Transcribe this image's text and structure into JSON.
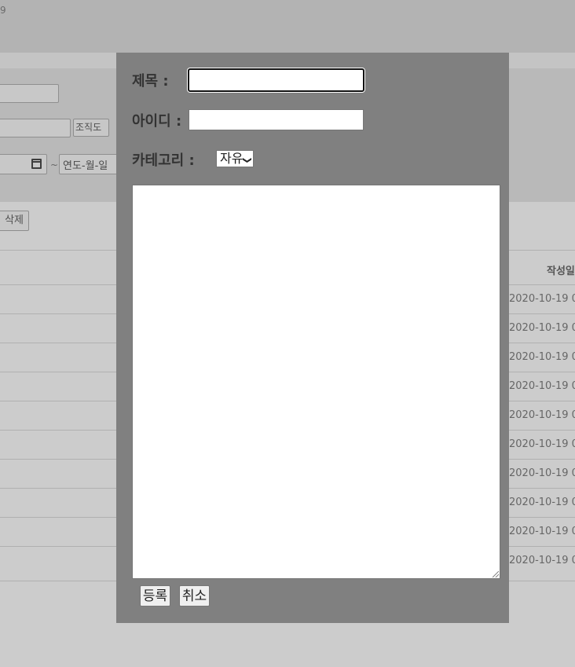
{
  "page": {
    "topbar_text": "9",
    "buttons": {
      "org_chart": "조직도",
      "delete": "삭제"
    },
    "date_range": {
      "separator": "~",
      "end_placeholder": "연도-월-일"
    },
    "table": {
      "header_date": "작성일",
      "row_dates": [
        "2020-10-19 0",
        "2020-10-19 0",
        "2020-10-19 0",
        "2020-10-19 0",
        "2020-10-19 0",
        "2020-10-19 0",
        "2020-10-19 0",
        "2020-10-19 0",
        "2020-10-19 0",
        "2020-10-19 0"
      ]
    }
  },
  "modal": {
    "title_label": "제목 :",
    "title_value": "",
    "id_label": "아이디 :",
    "id_value": "",
    "category_label": "카테고리 :",
    "category_selected": "자유",
    "content_value": "",
    "submit_label": "등록",
    "cancel_label": "취소"
  }
}
